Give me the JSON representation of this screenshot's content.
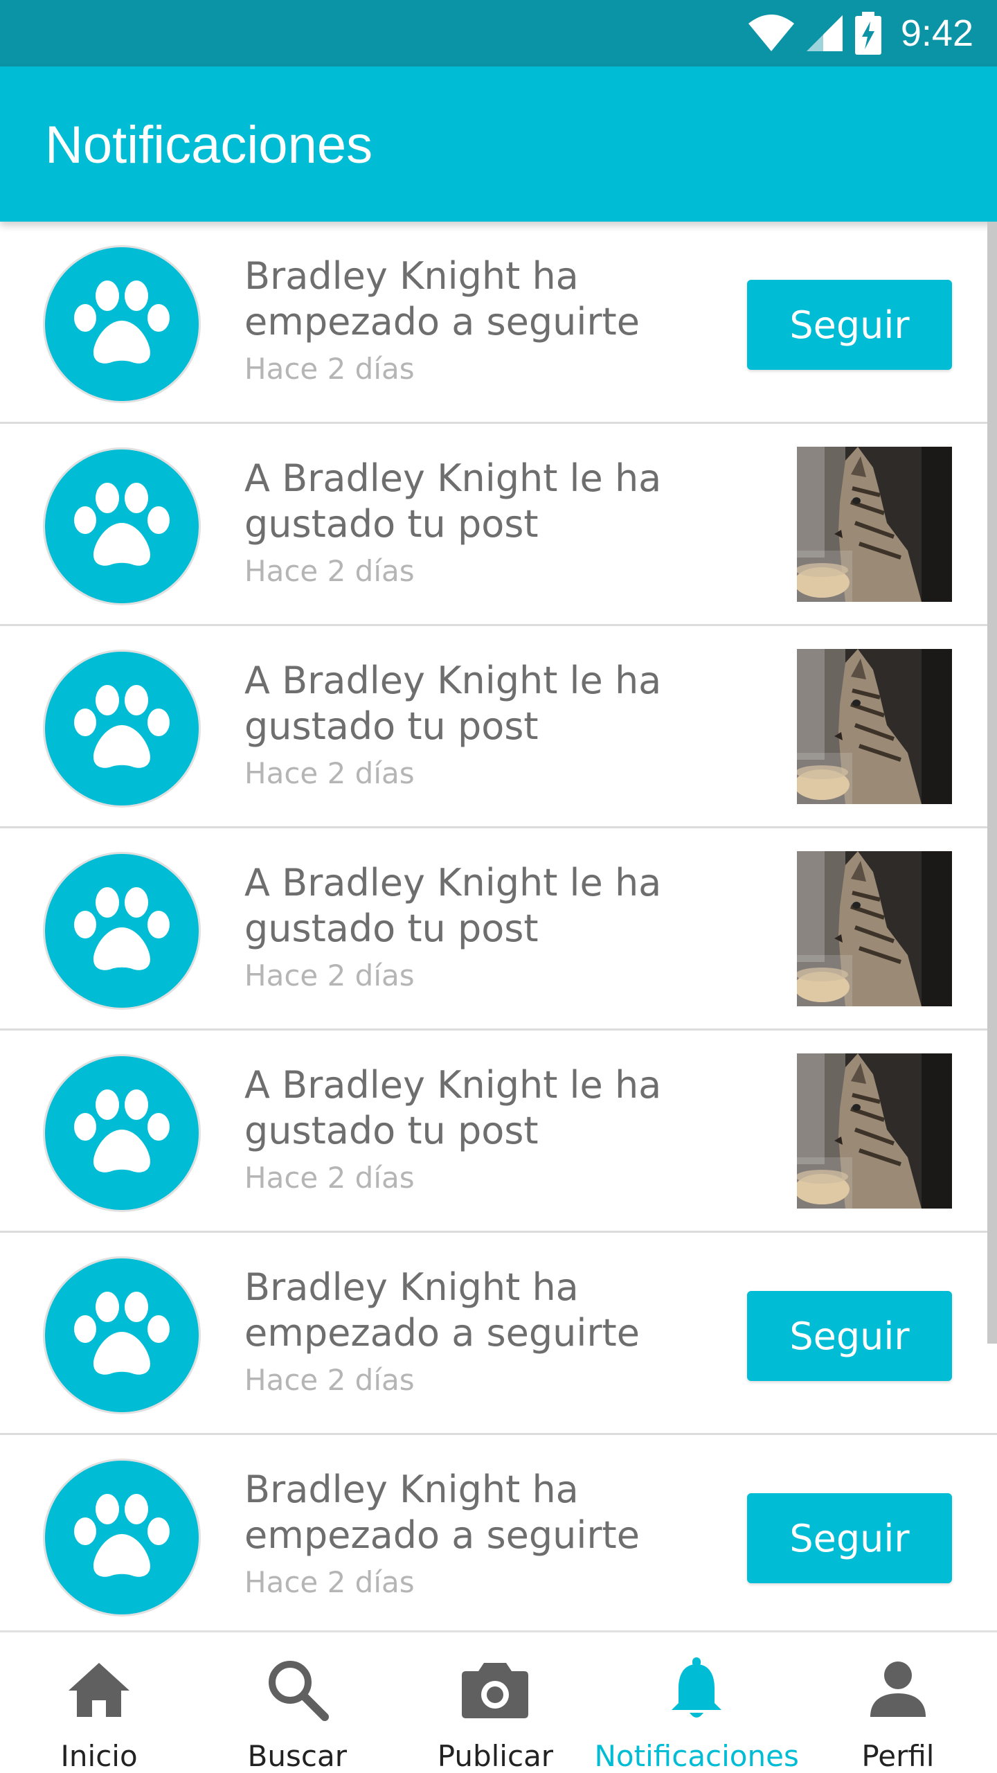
{
  "status_bar": {
    "time": "9:42",
    "icons": [
      "wifi-icon",
      "signal-icon",
      "battery-charging-icon"
    ]
  },
  "app_bar": {
    "title": "Notificaciones"
  },
  "colors": {
    "primary": "#00bcd4",
    "status_bar": "#0b94a6",
    "text_primary": "#6e6e6e",
    "text_secondary": "#b5b5b5",
    "nav_inactive_icon": "#606060"
  },
  "notifications": [
    {
      "type": "follow",
      "message": "Bradley Knight ha\nempezado a seguirte",
      "time": "Hace 2 días",
      "action_label": "Seguir",
      "avatar_icon": "paw-icon"
    },
    {
      "type": "like",
      "message": "A Bradley Knight le ha\ngustado tu post",
      "time": "Hace 2 días",
      "thumbnail": "cat-photo",
      "avatar_icon": "paw-icon"
    },
    {
      "type": "like",
      "message": "A Bradley Knight le ha\ngustado tu post",
      "time": "Hace 2 días",
      "thumbnail": "cat-photo",
      "avatar_icon": "paw-icon"
    },
    {
      "type": "like",
      "message": "A Bradley Knight le ha\ngustado tu post",
      "time": "Hace 2 días",
      "thumbnail": "cat-photo",
      "avatar_icon": "paw-icon"
    },
    {
      "type": "like",
      "message": "A Bradley Knight le ha\ngustado tu post",
      "time": "Hace 2 días",
      "thumbnail": "cat-photo",
      "avatar_icon": "paw-icon"
    },
    {
      "type": "follow",
      "message": "Bradley Knight ha\nempezado a seguirte",
      "time": "Hace 2 días",
      "action_label": "Seguir",
      "avatar_icon": "paw-icon"
    },
    {
      "type": "follow",
      "message": "Bradley Knight ha\nempezado a seguirte",
      "time": "Hace 2 días",
      "action_label": "Seguir",
      "avatar_icon": "paw-icon"
    }
  ],
  "bottom_nav": {
    "items": [
      {
        "label": "Inicio",
        "icon": "home-icon",
        "active": false
      },
      {
        "label": "Buscar",
        "icon": "search-icon",
        "active": false
      },
      {
        "label": "Publicar",
        "icon": "camera-icon",
        "active": false
      },
      {
        "label": "Notificaciones",
        "icon": "bell-icon",
        "active": true
      },
      {
        "label": "Perfil",
        "icon": "person-icon",
        "active": false
      }
    ]
  }
}
